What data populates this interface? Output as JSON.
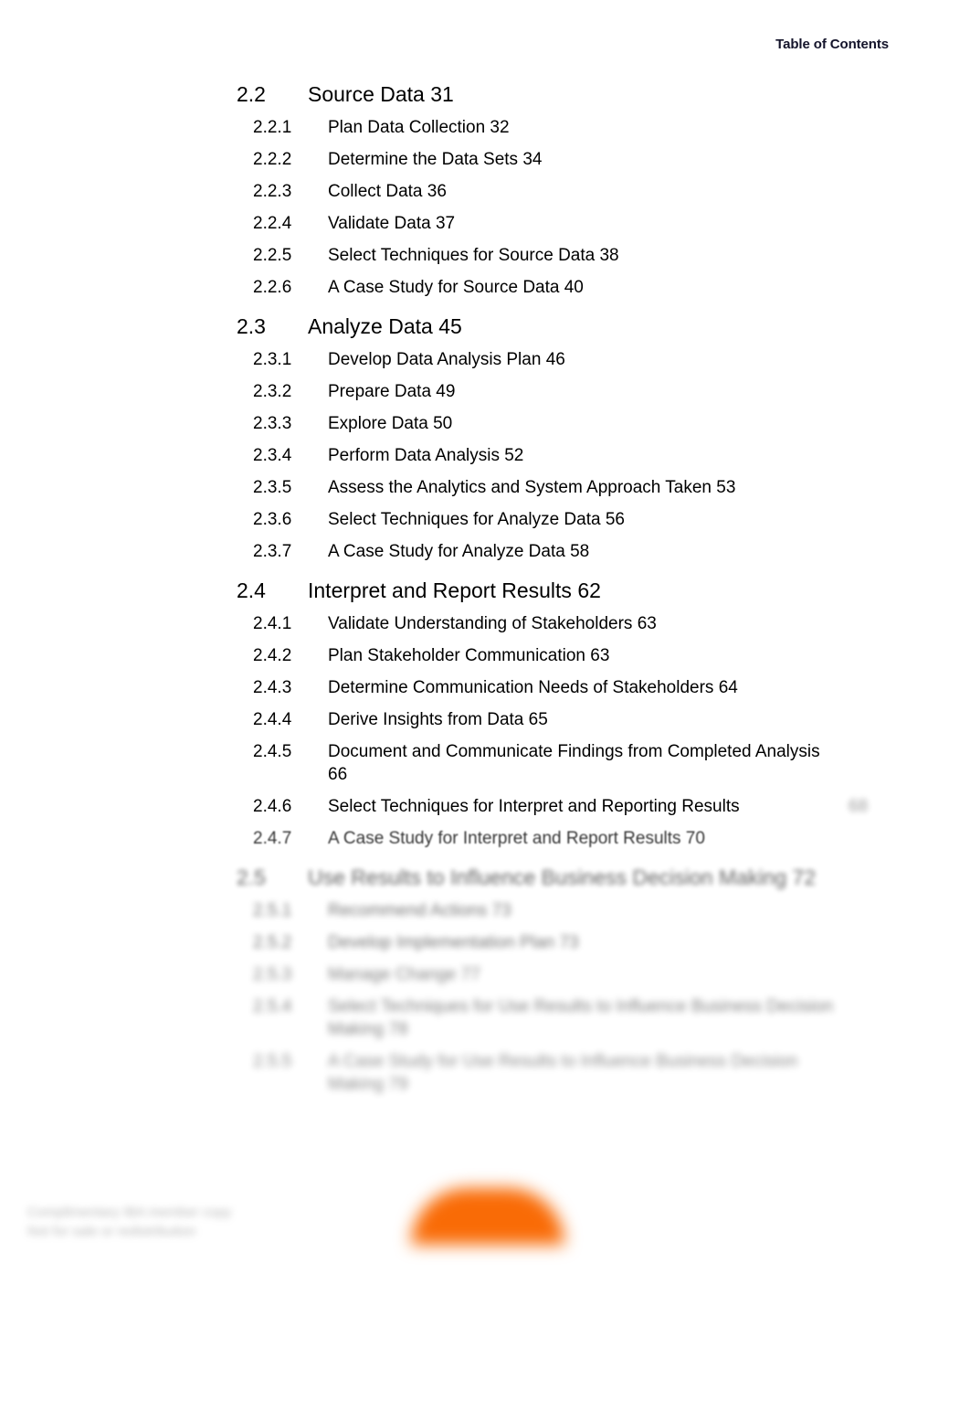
{
  "header": {
    "running_head": "Table of Contents"
  },
  "toc": {
    "entries": [
      {
        "level": 2,
        "number": "2.2",
        "title": "Source  Data  31",
        "blur": 0
      },
      {
        "level": 3,
        "number": "2.2.1",
        "title": "Plan  Data  Collection  32",
        "blur": 0
      },
      {
        "level": 3,
        "number": "2.2.2",
        "title": "Determine  the  Data  Sets  34",
        "blur": 0
      },
      {
        "level": 3,
        "number": "2.2.3",
        "title": "Collect  Data  36",
        "blur": 0
      },
      {
        "level": 3,
        "number": "2.2.4",
        "title": "Validate  Data  37",
        "blur": 0
      },
      {
        "level": 3,
        "number": "2.2.5",
        "title": "Select Techniques for Source Data   38",
        "blur": 0
      },
      {
        "level": 3,
        "number": "2.2.6",
        "title": "A Case Study for Source Data   40",
        "blur": 0
      },
      {
        "level": 2,
        "number": "2.3",
        "title": "Analyze  Data  45",
        "blur": 0
      },
      {
        "level": 3,
        "number": "2.3.1",
        "title": "Develop  Data  Analysis  Plan  46",
        "blur": 0
      },
      {
        "level": 3,
        "number": "2.3.2",
        "title": "Prepare  Data  49",
        "blur": 0
      },
      {
        "level": 3,
        "number": "2.3.3",
        "title": "Explore  Data  50",
        "blur": 0
      },
      {
        "level": 3,
        "number": "2.3.4",
        "title": "Perform  Data  Analysis  52",
        "blur": 0
      },
      {
        "level": 3,
        "number": "2.3.5",
        "title": "Assess the Analytics and System Approach Taken   53",
        "blur": 0
      },
      {
        "level": 3,
        "number": "2.3.6",
        "title": "Select Techniques for Analyze Data   56",
        "blur": 0
      },
      {
        "level": 3,
        "number": "2.3.7",
        "title": "A Case Study for Analyze Data   58",
        "blur": 0
      },
      {
        "level": 2,
        "number": "2.4",
        "title": "Interpret  and  Report  Results 62",
        "blur": 0
      },
      {
        "level": 3,
        "number": "2.4.1",
        "title": "Validate  Understanding  of  Stakeholders  63",
        "blur": 0
      },
      {
        "level": 3,
        "number": "2.4.2",
        "title": "Plan  Stakeholder  Communication  63",
        "blur": 0
      },
      {
        "level": 3,
        "number": "2.4.3",
        "title": "Determine Communication Needs of Stakeholders   64",
        "blur": 0
      },
      {
        "level": 3,
        "number": "2.4.4",
        "title": "Derive  Insights  from  Data  65",
        "blur": 0
      },
      {
        "level": 3,
        "number": "2.4.5",
        "title": "Document and Communicate Findings from Completed Analysis   66",
        "blur": 0
      },
      {
        "level": 3,
        "number": "2.4.6",
        "title": "Select Techniques for Interpret and Reporting Results",
        "page_faded": "68",
        "blur": 0
      },
      {
        "level": 3,
        "number": "2.4.7",
        "title": "A Case Study for Interpret and Report Results   70",
        "blur": 1
      },
      {
        "level": 2,
        "number": "2.5",
        "title": "Use Results to Influence Business Decision Making   72",
        "blur": 2
      },
      {
        "level": 3,
        "number": "2.5.1",
        "title": "Recommend Actions   73",
        "blur": 3
      },
      {
        "level": 3,
        "number": "2.5.2",
        "title": "Develop Implementation Plan   73",
        "blur": 3
      },
      {
        "level": 3,
        "number": "2.5.3",
        "title": "Manage Change   77",
        "blur": 4
      },
      {
        "level": 3,
        "number": "2.5.4",
        "title": "Select Techniques for Use Results to Influence Business Decision Making   78",
        "blur": 4
      },
      {
        "level": 3,
        "number": "2.5.5",
        "title": "A Case Study for Use Results to Influence Business Decision Making   79",
        "blur": 5
      }
    ]
  },
  "footer": {
    "caption_line1": "Complimentary IBA member copy",
    "caption_line2": "Not for sale or redistribution",
    "logo_color": "#f96b06"
  }
}
